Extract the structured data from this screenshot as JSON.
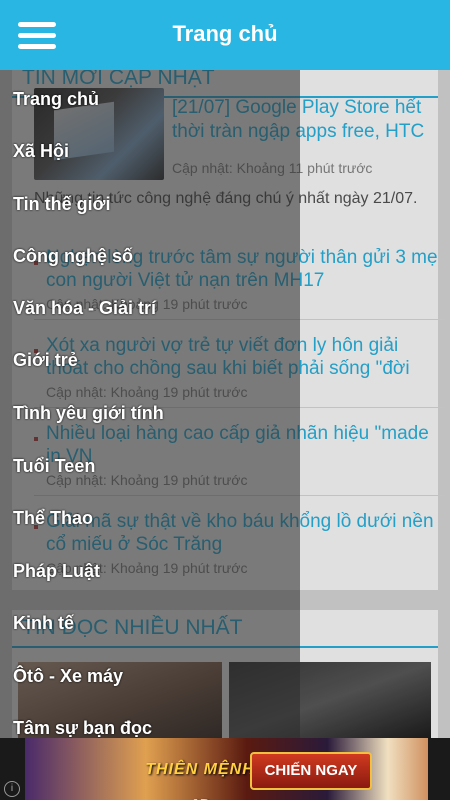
{
  "appbar": {
    "title": "Trang chủ"
  },
  "sections": {
    "latest": {
      "header": "TIN MỚI CẬP NHẬT",
      "featured": {
        "title": "[21/07] Google Play Store hết thời tràn ngập apps free, HTC",
        "meta": "Cập nhật:  Khoảng 11 phút trước",
        "desc": "Những tin tức công nghệ đáng chú ý nhất ngày 21/07."
      },
      "items": [
        {
          "title": "Nghẹn lòng trước tâm sự người thân gửi 3 mẹ con người Việt tử nạn trên MH17",
          "meta": "Cập nhật:  Khoảng 19 phút trước"
        },
        {
          "title": "Xót xa người vợ trẻ tự viết đơn ly hôn giải thoát cho chồng sau khi biết phải sống \"đời",
          "meta": "Cập nhật:  Khoảng 19 phút trước"
        },
        {
          "title": "Nhiều loại hàng cao cấp giả nhãn hiệu \"made in VN",
          "meta": "Cập nhật:  Khoảng 19 phút trước"
        },
        {
          "title": "Giải mã sự thật về kho báu khổng lồ dưới nền cổ miếu ở Sóc Trăng",
          "meta": "Cập nhật:  Khoảng 19 phút trước"
        }
      ]
    },
    "popular": {
      "header": "TIN ĐỌC NHIỀU NHẤT"
    }
  },
  "menu": {
    "items": [
      "Trang chủ",
      "Xã Hội",
      "Tin thế giới",
      "Công nghệ số",
      "Văn hóa - Giải trí",
      "Giới trẻ",
      "Tình yêu giới tính",
      "Tuổi Teen",
      "Thể Thao",
      "Pháp Luật",
      "Kinh tế",
      "Ôtô - Xe máy",
      "Tâm sự bạn đọc"
    ]
  },
  "ad": {
    "info_icon": "i",
    "logo_text": "THIÊN MỆNH 4D",
    "cta": "CHIẾN NGAY"
  },
  "colors": {
    "accent": "#29b6e3",
    "drawer": "#3a3a3a"
  }
}
